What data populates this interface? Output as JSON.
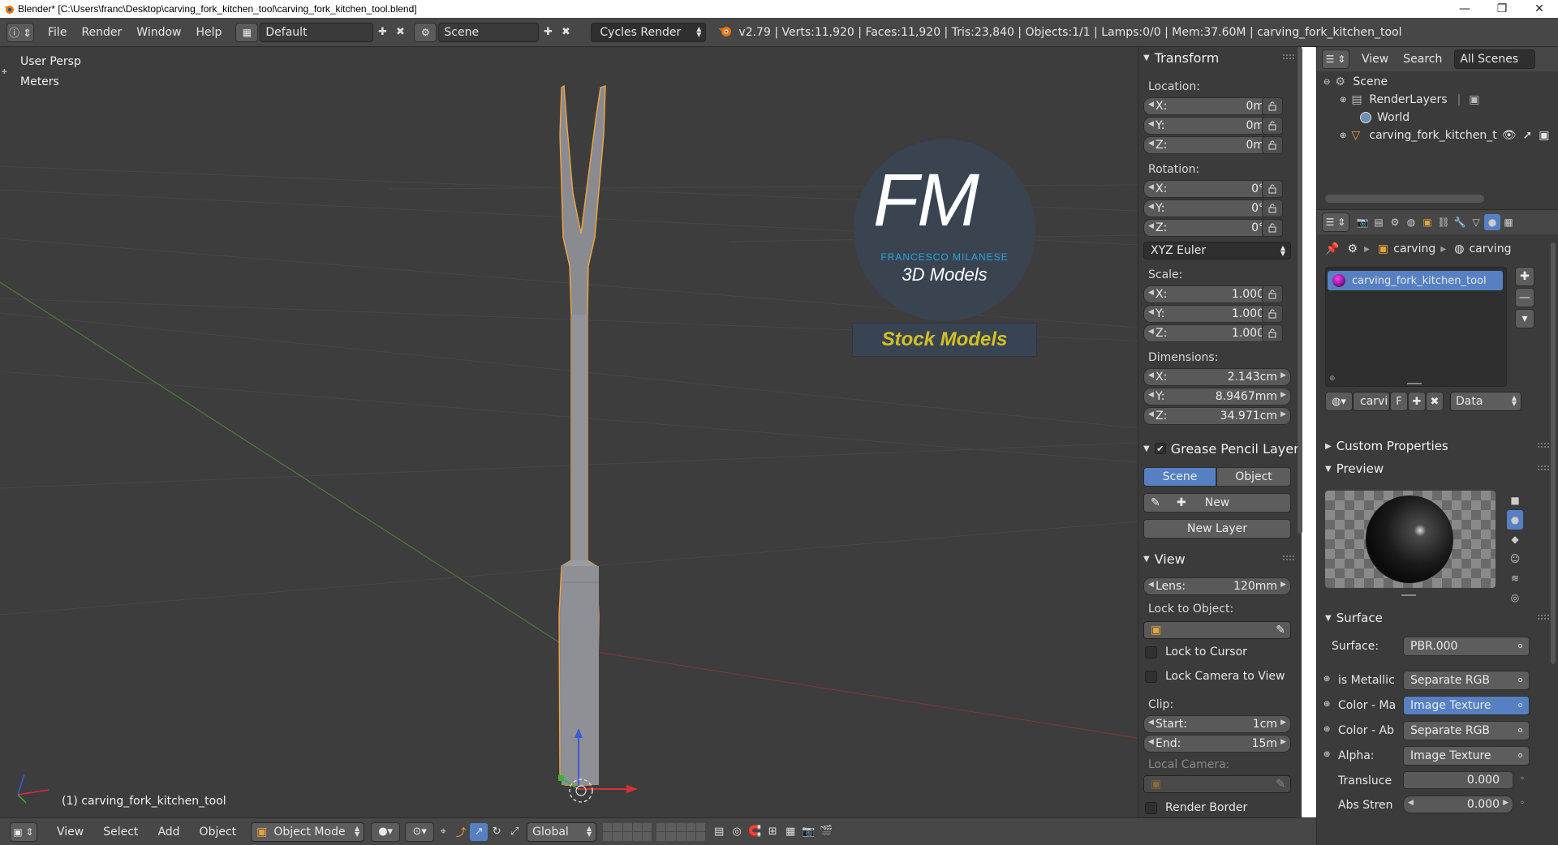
{
  "window": {
    "title": "Blender* [C:\\Users\\franc\\Desktop\\carving_fork_kitchen_tool\\carving_fork_kitchen_tool.blend]",
    "minimize": "—",
    "maximize": "❐",
    "close": "✕"
  },
  "infobar": {
    "menus": [
      "File",
      "Render",
      "Window",
      "Help"
    ],
    "layout": "Default",
    "scene": "Scene",
    "engine": "Cycles Render",
    "stats": "v2.79 | Verts:11,920 | Faces:11,920 | Tris:23,840 | Objects:1/1 | Lamps:0/0 | Mem:37.60M | carving_fork_kitchen_tool"
  },
  "viewport": {
    "view_name": "User Persp",
    "units": "Meters",
    "selected_object": "(1) carving_fork_kitchen_tool",
    "watermark": {
      "initials": "FM",
      "company": "FRANCESCO MILANESE",
      "subtitle": "3D Models",
      "banner": "Stock Models"
    }
  },
  "transform_panel": {
    "title": "Transform",
    "location_label": "Location:",
    "location": [
      {
        "axis": "X:",
        "value": "0m"
      },
      {
        "axis": "Y:",
        "value": "0m"
      },
      {
        "axis": "Z:",
        "value": "0m"
      }
    ],
    "rotation_label": "Rotation:",
    "rotation": [
      {
        "axis": "X:",
        "value": "0°"
      },
      {
        "axis": "Y:",
        "value": "0°"
      },
      {
        "axis": "Z:",
        "value": "0°"
      }
    ],
    "rotation_mode": "XYZ Euler",
    "scale_label": "Scale:",
    "scale": [
      {
        "axis": "X:",
        "value": "1.000"
      },
      {
        "axis": "Y:",
        "value": "1.000"
      },
      {
        "axis": "Z:",
        "value": "1.000"
      }
    ],
    "dimensions_label": "Dimensions:",
    "dimensions": [
      {
        "axis": "X:",
        "value": "2.143cm"
      },
      {
        "axis": "Y:",
        "value": "8.9467mm"
      },
      {
        "axis": "Z:",
        "value": "34.971cm"
      }
    ]
  },
  "grease_pencil": {
    "title": "Grease Pencil Layer",
    "tabs": [
      "Scene",
      "Object"
    ],
    "new_label": "New",
    "new_layer_label": "New Layer"
  },
  "view_panel": {
    "title": "View",
    "lens_label": "Lens:",
    "lens_value": "120mm",
    "lock_to_object_label": "Lock to Object:",
    "lock_to_cursor": "Lock to Cursor",
    "lock_camera": "Lock Camera to View",
    "clip_label": "Clip:",
    "clip_start_label": "Start:",
    "clip_start": "1cm",
    "clip_end_label": "End:",
    "clip_end": "15m",
    "local_camera_label": "Local Camera:",
    "render_border": "Render Border"
  },
  "outliner": {
    "menus": [
      "View",
      "Search"
    ],
    "filter": "All Scenes",
    "items": [
      "Scene",
      "RenderLayers",
      "World",
      "carving_fork_kitchen_t"
    ]
  },
  "properties": {
    "breadcrumb": [
      "carving",
      "carving"
    ],
    "material_slot": "carving_fork_kitchen_tool",
    "material_name": "carvi",
    "fake_user": "F",
    "link": "Data",
    "custom_properties": "Custom Properties",
    "preview": "Preview",
    "surface_title": "Surface",
    "surface_label": "Surface:",
    "surface_value": "PBR.000",
    "inputs": [
      {
        "label": "is Metallic",
        "value": "Separate RGB"
      },
      {
        "label": "Color - Ma",
        "value": "Image Texture"
      },
      {
        "label": "Color - Ab",
        "value": "Separate RGB"
      },
      {
        "label": "Alpha:",
        "value": "Image Texture"
      }
    ],
    "translucency_label": "Transluce",
    "translucency_value": "0.000",
    "abs_strength_label": "Abs Stren",
    "abs_strength_value": "0.000"
  },
  "footer": {
    "menus": [
      "View",
      "Select",
      "Add",
      "Object"
    ],
    "mode": "Object Mode",
    "orientation": "Global"
  },
  "colors": {
    "viewport_bg": "#3d3d3d",
    "selection_outline": "#f2a541",
    "accent_blue": "#5680c2",
    "watermark_blue": "#28a6de",
    "watermark_yellow": "#d4c024"
  }
}
